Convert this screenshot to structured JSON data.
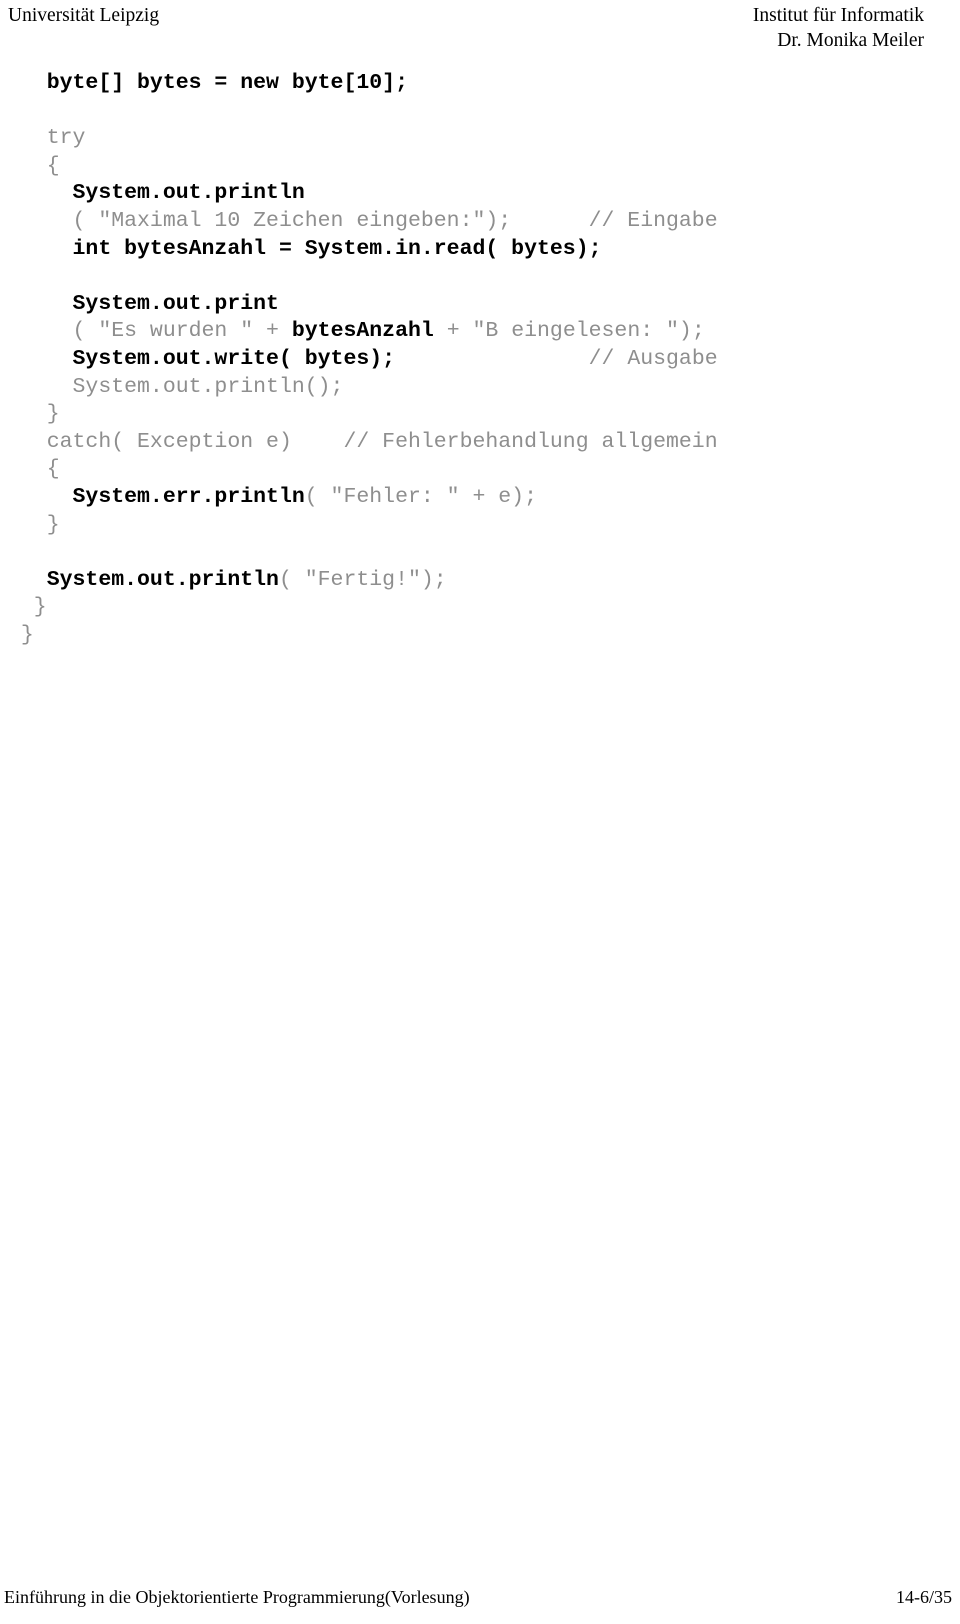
{
  "header": {
    "institution": "Universität Leipzig",
    "institute": "Institut für Informatik",
    "lecturer": "Dr. Monika Meiler"
  },
  "footer": {
    "course": "Einführung in die Objektorientierte Programmierung(Vorlesung)",
    "page": "14-6/35"
  },
  "code": {
    "language": "java",
    "colors": {
      "emphasis": "#000000",
      "normal": "#8e8e8e",
      "background": "#ffffff"
    },
    "lines": [
      {
        "id": "l1",
        "segments": [
          {
            "text": "   byte[] bytes = new byte[10];",
            "style": "b"
          }
        ]
      },
      {
        "id": "l2",
        "segments": [
          {
            "text": "",
            "style": "g"
          }
        ]
      },
      {
        "id": "l3",
        "segments": [
          {
            "text": "   try",
            "style": "g"
          }
        ]
      },
      {
        "id": "l4",
        "segments": [
          {
            "text": "   {",
            "style": "g"
          }
        ]
      },
      {
        "id": "l5",
        "segments": [
          {
            "text": "     System.out.println",
            "style": "b"
          }
        ]
      },
      {
        "id": "l6",
        "segments": [
          {
            "text": "     ( \"Maximal 10 Zeichen eingeben:\");      // Eingabe",
            "style": "g"
          }
        ]
      },
      {
        "id": "l7",
        "segments": [
          {
            "text": "     int bytesAnzahl = System.in.read( bytes);",
            "style": "b"
          }
        ]
      },
      {
        "id": "l8",
        "segments": [
          {
            "text": "",
            "style": "g"
          }
        ]
      },
      {
        "id": "l9",
        "segments": [
          {
            "text": "     System.out.print",
            "style": "b"
          }
        ]
      },
      {
        "id": "l10",
        "segments": [
          {
            "text": "     ( \"Es wurden \" + ",
            "style": "g"
          },
          {
            "text": "bytesAnzahl",
            "style": "b"
          },
          {
            "text": " + \"B eingelesen: \");",
            "style": "g"
          }
        ]
      },
      {
        "id": "l11",
        "segments": [
          {
            "text": "     System.out.write( bytes);",
            "style": "b"
          },
          {
            "text": "               // Ausgabe",
            "style": "g"
          }
        ]
      },
      {
        "id": "l12",
        "segments": [
          {
            "text": "     System.out.println();",
            "style": "g"
          }
        ]
      },
      {
        "id": "l13",
        "segments": [
          {
            "text": "   }",
            "style": "g"
          }
        ]
      },
      {
        "id": "l14",
        "segments": [
          {
            "text": "   catch( Exception e)    // Fehlerbehandlung allgemein",
            "style": "g"
          }
        ]
      },
      {
        "id": "l15",
        "segments": [
          {
            "text": "   {",
            "style": "g"
          }
        ]
      },
      {
        "id": "l16",
        "segments": [
          {
            "text": "     System.err.println",
            "style": "b"
          },
          {
            "text": "( \"Fehler: \" + e);",
            "style": "g"
          }
        ]
      },
      {
        "id": "l17",
        "segments": [
          {
            "text": "   }",
            "style": "g"
          }
        ]
      },
      {
        "id": "l18",
        "segments": [
          {
            "text": "",
            "style": "g"
          }
        ]
      },
      {
        "id": "l19",
        "segments": [
          {
            "text": "   System.out.println",
            "style": "b"
          },
          {
            "text": "( \"Fertig!\");",
            "style": "g"
          }
        ]
      },
      {
        "id": "l20",
        "segments": [
          {
            "text": "  }",
            "style": "g"
          }
        ]
      },
      {
        "id": "l21",
        "segments": [
          {
            "text": " }",
            "style": "g"
          }
        ]
      }
    ]
  }
}
